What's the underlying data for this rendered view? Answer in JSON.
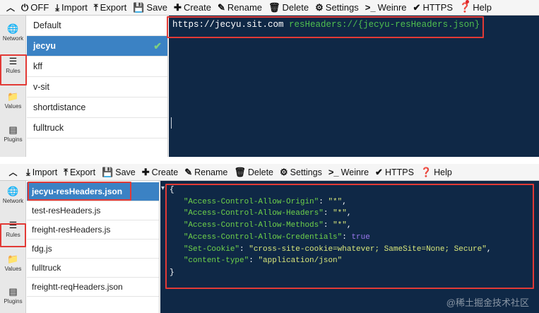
{
  "top_toolbar": {
    "items": [
      {
        "icon": "power-icon",
        "glyph": "⏻",
        "label": "OFF"
      },
      {
        "icon": "import-icon",
        "glyph": "⤓",
        "label": "Import"
      },
      {
        "icon": "export-icon",
        "glyph": "⤒",
        "label": "Export"
      },
      {
        "icon": "save-icon",
        "glyph": "💾",
        "label": "Save"
      },
      {
        "icon": "plus-icon",
        "glyph": "✚",
        "label": "Create"
      },
      {
        "icon": "edit-icon",
        "glyph": "✎",
        "label": "Rename"
      },
      {
        "icon": "trash-icon",
        "glyph": "🗑",
        "label": "Delete"
      },
      {
        "icon": "gear-icon",
        "glyph": "⚙",
        "label": "Settings"
      },
      {
        "icon": "terminal-icon",
        "glyph": ">_",
        "label": "Weinre"
      },
      {
        "icon": "checkmark-icon",
        "glyph": "✔",
        "label": "HTTPS"
      },
      {
        "icon": "help-icon",
        "glyph": "❓",
        "label": "Help"
      }
    ]
  },
  "bottom_toolbar": {
    "items": [
      {
        "icon": "import-icon",
        "glyph": "⤓",
        "label": "Import"
      },
      {
        "icon": "export-icon",
        "glyph": "⤒",
        "label": "Export"
      },
      {
        "icon": "save-icon",
        "glyph": "💾",
        "label": "Save"
      },
      {
        "icon": "plus-icon",
        "glyph": "✚",
        "label": "Create"
      },
      {
        "icon": "edit-icon",
        "glyph": "✎",
        "label": "Rename"
      },
      {
        "icon": "trash-icon",
        "glyph": "🗑",
        "label": "Delete"
      },
      {
        "icon": "gear-icon",
        "glyph": "⚙",
        "label": "Settings"
      },
      {
        "icon": "terminal-icon",
        "glyph": ">_",
        "label": "Weinre"
      },
      {
        "icon": "checkmark-icon",
        "glyph": "✔",
        "label": "HTTPS"
      },
      {
        "icon": "help-icon",
        "glyph": "❓",
        "label": "Help"
      }
    ]
  },
  "sidebar": {
    "items": [
      {
        "icon": "globe-icon",
        "glyph": "🌐",
        "label": "Network"
      },
      {
        "icon": "list-icon",
        "glyph": "☰",
        "label": "Rules"
      },
      {
        "icon": "folder-icon",
        "glyph": "📁",
        "label": "Values"
      },
      {
        "icon": "plugins-icon",
        "glyph": "▤",
        "label": "Plugins"
      }
    ]
  },
  "rules_list": {
    "items": [
      "Default",
      "jecyu",
      "kff",
      "v-sit",
      "shortdistance",
      "fulltruck"
    ],
    "active": "jecyu",
    "check_glyph": "✔"
  },
  "rules_editor": {
    "host": "https://jecyu.sit.com",
    "rule": "resHeaders://{jecyu-resHeaders.json}"
  },
  "values_list": {
    "items": [
      "jecyu-resHeaders.json",
      "test-resHeaders.js",
      "freight-resHeaders.js",
      "fdg.js",
      "fulltruck",
      "freightt-reqHeaders.json"
    ],
    "active": "jecyu-resHeaders.json"
  },
  "values_editor": {
    "fold_marker": "▾",
    "open_brace": "{",
    "close_brace": "}",
    "entries": [
      {
        "key": "\"Access-Control-Allow-Origin\"",
        "value": "\"*\"",
        "comma": ","
      },
      {
        "key": "\"Access-Control-Allow-Headers\"",
        "value": "\"*\"",
        "comma": ","
      },
      {
        "key": "\"Access-Control-Allow-Methods\"",
        "value": "\"*\"",
        "comma": ","
      },
      {
        "key": "\"Access-Control-Allow-Credentials\"",
        "value": "true",
        "comma": ""
      },
      {
        "key": "\"Set-Cookie\"",
        "value": "\"cross-site-cookie=whatever; SameSite=None; Secure\"",
        "comma": ","
      },
      {
        "key": "\"content-type\"",
        "value": "\"application/json\"",
        "comma": ""
      }
    ]
  },
  "watermark": "@稀土掘金技术社区",
  "colors": {
    "editor_bg": "#0f2846",
    "accent": "#3b82c4",
    "highlight_box": "#e23a36",
    "json_key": "#6fd24a",
    "json_string": "#d9e77a",
    "json_keyword": "#9b78f0",
    "rule_text": "#4fbf4f"
  }
}
